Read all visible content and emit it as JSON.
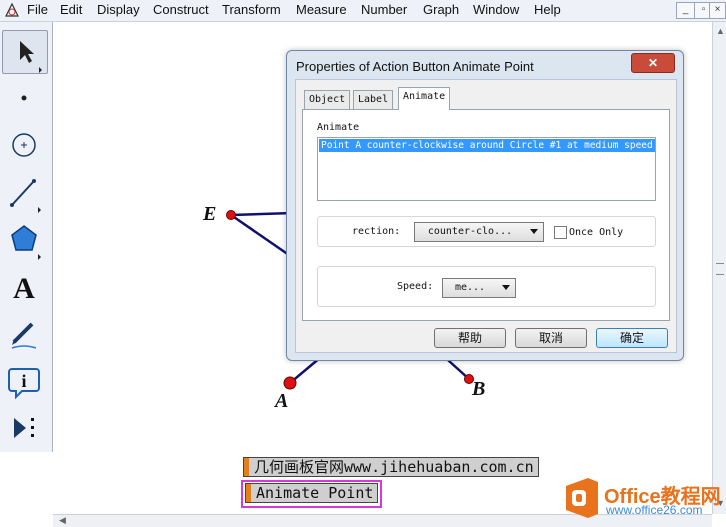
{
  "menu": {
    "items": [
      "File",
      "Edit",
      "Display",
      "Construct",
      "Transform",
      "Measure",
      "Number",
      "Graph",
      "Window",
      "Help"
    ]
  },
  "window_controls": {
    "minimize": "_",
    "restore": "▫",
    "close": "×"
  },
  "toolbox": {
    "tools": [
      {
        "name": "arrow-select-tool",
        "icon": "arrow-icon",
        "selected": true
      },
      {
        "name": "point-tool",
        "icon": "point-icon"
      },
      {
        "name": "compass-tool",
        "icon": "circle-icon"
      },
      {
        "name": "straightedge-tool",
        "icon": "line-icon"
      },
      {
        "name": "polygon-tool",
        "icon": "pentagon-icon"
      },
      {
        "name": "text-tool",
        "icon": "text-A-icon",
        "glyph": "A"
      },
      {
        "name": "marker-tool",
        "icon": "pen-icon"
      },
      {
        "name": "information-tool",
        "icon": "info-icon",
        "glyph": "i"
      },
      {
        "name": "custom-tool",
        "icon": "play-dots-icon"
      }
    ]
  },
  "canvas": {
    "point_labels": {
      "E": "E",
      "A": "A",
      "B": "B"
    },
    "colors": {
      "point": "#dd1111",
      "segment": "#101070"
    },
    "buttons": {
      "website": "几何画板官网www.jihehuaban.com.cn",
      "animate": "Animate Point"
    }
  },
  "dialog": {
    "title": "Properties of Action Button Animate Point",
    "close": "✕",
    "tabs": [
      "Object",
      "Label",
      "Animate"
    ],
    "active_tab": "Animate",
    "animate_label": "Animate",
    "animate_item": "Point A counter-clockwise around Circle #1 at medium speed",
    "direction_label": "rection:",
    "direction_value": "counter-clo...",
    "once_only_label": "Once Only",
    "once_only_checked": false,
    "speed_label": "Speed:",
    "speed_value": "me...",
    "buttons": {
      "help": "帮助",
      "cancel": "取消",
      "ok": "确定"
    }
  },
  "watermark": {
    "title": "Office教程网",
    "url": "www.office26.com"
  }
}
